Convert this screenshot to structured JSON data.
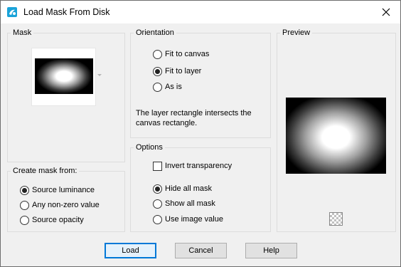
{
  "window": {
    "title": "Load Mask From Disk",
    "icon": "psp-app-icon",
    "close_icon": "close-icon"
  },
  "mask": {
    "title": "Mask"
  },
  "create_mask_from": {
    "title": "Create mask from:",
    "options": [
      {
        "label": "Source luminance",
        "selected": true
      },
      {
        "label": "Any non-zero value",
        "selected": false
      },
      {
        "label": "Source opacity",
        "selected": false
      }
    ]
  },
  "orientation": {
    "title": "Orientation",
    "options": [
      {
        "label": "Fit to canvas",
        "selected": false
      },
      {
        "label": "Fit to layer",
        "selected": true
      },
      {
        "label": "As is",
        "selected": false
      }
    ],
    "description_line1": "The layer rectangle intersects the",
    "description_line2": "canvas rectangle."
  },
  "options": {
    "title": "Options",
    "invert_label": "Invert transparency",
    "invert_checked": false,
    "radios": [
      {
        "label": "Hide all mask",
        "selected": true
      },
      {
        "label": "Show all mask",
        "selected": false
      },
      {
        "label": "Use image value",
        "selected": false
      }
    ]
  },
  "preview": {
    "title": "Preview"
  },
  "buttons": {
    "load": "Load",
    "cancel": "Cancel",
    "help": "Help"
  }
}
